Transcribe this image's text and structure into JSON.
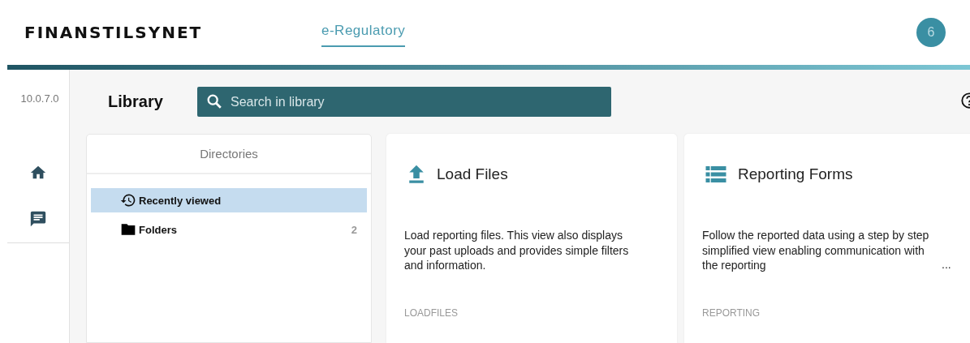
{
  "header": {
    "logo": "FINANSTILSYNET",
    "nav": [
      {
        "label": "e-Regulatory",
        "selected": true
      }
    ],
    "badge": "6"
  },
  "rail": {
    "version": "10.0.7.0",
    "items": [
      {
        "kind": "home"
      },
      {
        "kind": "chat"
      }
    ]
  },
  "library": {
    "title": "Library",
    "search": {
      "placeholder": "Search in library"
    }
  },
  "directories": {
    "title": "Directories",
    "items": [
      {
        "kind": "history",
        "label": "Recently viewed",
        "selected": true
      },
      {
        "kind": "folder",
        "label": "Folders",
        "count": "2",
        "selected": false
      }
    ]
  },
  "cards": [
    {
      "kind": "upload",
      "title": "Load Files",
      "description": "Load reporting files. This view also displays your past uploads and provides simple filters and information.",
      "tag": "LOADFILES"
    },
    {
      "kind": "list",
      "title": "Reporting Forms",
      "description": "Follow the reported data using a step by step simplified view enabling communication with the reporting",
      "more": "...",
      "tag": "REPORTING"
    }
  ]
}
